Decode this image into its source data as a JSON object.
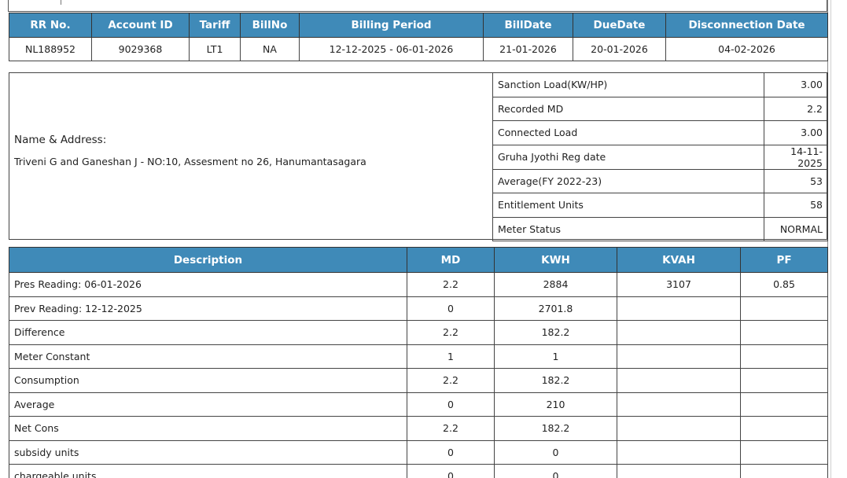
{
  "bill_header": {
    "columns": [
      "RR No.",
      "Account ID",
      "Tariff",
      "BillNo",
      "Billing Period",
      "BillDate",
      "DueDate",
      "Disconnection Date"
    ],
    "values": [
      "NL188952",
      "9029368",
      "LT1",
      "NA",
      "12-12-2025 - 06-01-2026",
      "21-01-2026",
      "20-01-2026",
      "04-02-2026"
    ]
  },
  "customer": {
    "name_label": "Name & Address:",
    "name_value": "Triveni G and Ganeshan J - NO:10, Assesment no 26, Hanumantasagara"
  },
  "load_info": [
    {
      "label": "Sanction Load(KW/HP)",
      "value": "3.00"
    },
    {
      "label": "Recorded MD",
      "value": "2.2"
    },
    {
      "label": "Connected Load",
      "value": "3.00"
    },
    {
      "label": "Gruha Jyothi Reg date",
      "value": "14-11-2025"
    },
    {
      "label": "Average(FY 2022-23)",
      "value": "53"
    },
    {
      "label": "Entitlement Units",
      "value": "58"
    },
    {
      "label": "Meter Status",
      "value": "NORMAL"
    }
  ],
  "readings": {
    "columns": [
      "Description",
      "MD",
      "KWH",
      "KVAH",
      "PF"
    ],
    "rows": [
      [
        "Pres Reading: 06-01-2026",
        "2.2",
        "2884",
        "3107",
        "0.85"
      ],
      [
        "Prev Reading: 12-12-2025",
        "0",
        "2701.8",
        "",
        ""
      ],
      [
        "Difference",
        "2.2",
        "182.2",
        "",
        ""
      ],
      [
        "Meter Constant",
        "1",
        "1",
        "",
        ""
      ],
      [
        "Consumption",
        "2.2",
        "182.2",
        "",
        ""
      ],
      [
        "Average",
        "0",
        "210",
        "",
        ""
      ],
      [
        "Net Cons",
        "2.2",
        "182.2",
        "",
        ""
      ],
      [
        "subsidy units",
        "0",
        "0",
        "",
        ""
      ],
      [
        "chargeable units",
        "0",
        "0",
        "",
        ""
      ]
    ]
  }
}
